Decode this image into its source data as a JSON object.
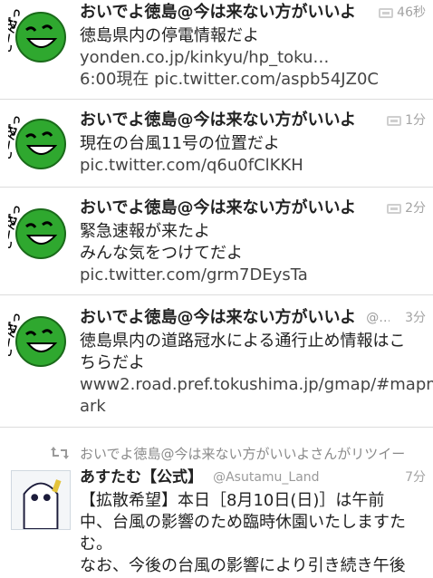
{
  "colors": {
    "accent_green": "#2fa82f",
    "text": "#222222",
    "meta": "#9a9a9a",
    "divider": "#dcdcdc"
  },
  "avatar_text": "どっどーん!",
  "tweets": [
    {
      "name": "おいでよ徳島@今は来ない方がいいよ",
      "screen": "",
      "time": "46秒",
      "has_media": true,
      "lines": [
        "徳島県内の停電情報だよ",
        "yonden.co.jp/kinkyu/hp_toku…",
        "6:00現在 pic.twitter.com/aspb54JZ0C"
      ]
    },
    {
      "name": "おいでよ徳島@今は来ない方がいいよ",
      "screen": "",
      "time": "1分",
      "has_media": true,
      "lines": [
        "現在の台風11号の位置だよ",
        "pic.twitter.com/q6u0fClKKH"
      ]
    },
    {
      "name": "おいでよ徳島@今は来ない方がいいよ",
      "screen": "",
      "time": "2分",
      "has_media": true,
      "lines": [
        "緊急速報が来たよ",
        "みんな気をつけてだよ",
        "pic.twitter.com/grm7DEysTa"
      ]
    },
    {
      "name": "おいでよ徳島@今は来ない方がいいよ",
      "screen": "@…",
      "time": "3分",
      "has_media": false,
      "lines": [
        "徳島県内の道路冠水による通行止め情報はこ",
        "ちらだよ",
        "www2.road.pref.tokushima.jp/gmap/#mapm",
        "ark"
      ]
    }
  ],
  "retweet": {
    "label": "おいでよ徳島@今は来ない方がいいよさんがリツイー",
    "name": "あすたむ【公式】",
    "screen": "@Asutamu_Land",
    "time": "7分",
    "lines": [
      "【拡散希望】本日［8月10日(日)］は午前",
      "中、台風の影響のため臨時休園いたしますた",
      "む。",
      "なお、今後の台風の影響により引き続き午後"
    ]
  }
}
